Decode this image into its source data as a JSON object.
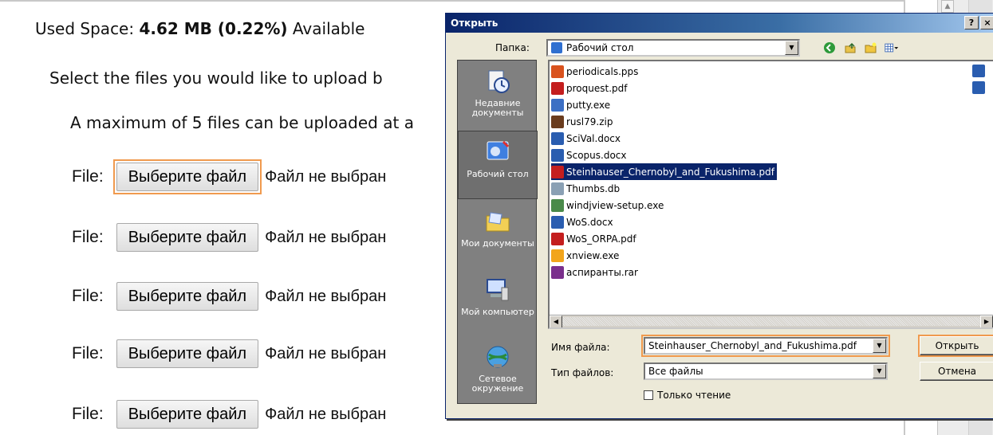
{
  "page": {
    "used_label": "Used Space:",
    "used_value": "4.62 MB (0.22%)",
    "available_label": "Available",
    "select_text": "Select the files you would like to upload b",
    "max_text": "A maximum of 5 files can be uploaded at a",
    "file_rows": [
      {
        "label": "File:",
        "button": "Выберите файл",
        "status": "Файл не выбран"
      },
      {
        "label": "File:",
        "button": "Выберите файл",
        "status": "Файл не выбран"
      },
      {
        "label": "File:",
        "button": "Выберите файл",
        "status": "Файл не выбран"
      },
      {
        "label": "File:",
        "button": "Выберите файл",
        "status": "Файл не выбран"
      },
      {
        "label": "File:",
        "button": "Выберите файл",
        "status": "Файл не выбран"
      }
    ]
  },
  "dialog": {
    "title": "Открыть",
    "help_button": "?",
    "close_button": "×",
    "lookin_label": "Папка:",
    "lookin_value": "Рабочий стол",
    "places": [
      {
        "label": "Недавние документы",
        "icon": "recent-docs-icon"
      },
      {
        "label": "Рабочий стол",
        "icon": "desktop-icon"
      },
      {
        "label": "Мои документы",
        "icon": "my-documents-icon"
      },
      {
        "label": "Мой компьютер",
        "icon": "my-computer-icon"
      },
      {
        "label": "Сетевое окружение",
        "icon": "network-icon"
      }
    ],
    "files": [
      {
        "name": "periodicals.pps",
        "type": "pps"
      },
      {
        "name": "proquest.pdf",
        "type": "pdf"
      },
      {
        "name": "putty.exe",
        "type": "exe"
      },
      {
        "name": "rusl79.zip",
        "type": "zip"
      },
      {
        "name": "SciVal.docx",
        "type": "docx"
      },
      {
        "name": "Scopus.docx",
        "type": "docx"
      },
      {
        "name": "Steinhauser_Chernobyl_and_Fukushima.pdf",
        "type": "pdf",
        "selected": true
      },
      {
        "name": "Thumbs.db",
        "type": "db"
      },
      {
        "name": "windjview-setup.exe",
        "type": "wv"
      },
      {
        "name": "WoS.docx",
        "type": "docx"
      },
      {
        "name": "WoS_ORPA.pdf",
        "type": "pdf"
      },
      {
        "name": "xnview.exe",
        "type": "xn"
      },
      {
        "name": "аспиранты.rar",
        "type": "rar"
      }
    ],
    "filename_label": "Имя файла:",
    "filename_value": "Steinhauser_Chernobyl_and_Fukushima.pdf",
    "filetype_label": "Тип файлов:",
    "filetype_value": "Все файлы",
    "readonly_label": "Только чтение",
    "open_button": "Открыть",
    "cancel_button": "Отмена"
  }
}
